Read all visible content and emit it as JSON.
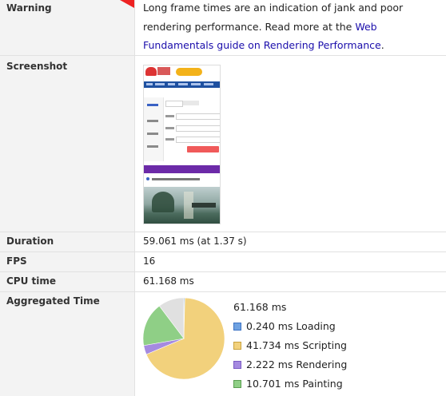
{
  "rows": {
    "warning": {
      "label": "Warning",
      "text_before": "Long frame times are an indication of jank and poor rendering performance. Read more at the ",
      "link": "Web Fundamentals guide on Rendering Performance",
      "text_after": "."
    },
    "screenshot": {
      "label": "Screenshot"
    },
    "duration": {
      "label": "Duration",
      "value": "59.061 ms (at 1.37 s)"
    },
    "fps": {
      "label": "FPS",
      "value": "16"
    },
    "cpu": {
      "label": "CPU time",
      "value": "61.168 ms"
    },
    "aggregated": {
      "label": "Aggregated Time"
    }
  },
  "aggregated_time": {
    "total": "61.168 ms",
    "items": [
      {
        "label": "0.240 ms Loading",
        "value_ms": 0.24,
        "color": "#6fa2e1",
        "border": "#3b72c4"
      },
      {
        "label": "41.734 ms Scripting",
        "value_ms": 41.734,
        "color": "#f2d17c",
        "border": "#c9a23e"
      },
      {
        "label": "2.222 ms Rendering",
        "value_ms": 2.222,
        "color": "#a58ae0",
        "border": "#7b5bc4"
      },
      {
        "label": "10.701 ms Painting",
        "value_ms": 10.701,
        "color": "#8fcf86",
        "border": "#5a9e50"
      }
    ],
    "other_ms": 6.271,
    "other_color": "#e0e0e0"
  }
}
